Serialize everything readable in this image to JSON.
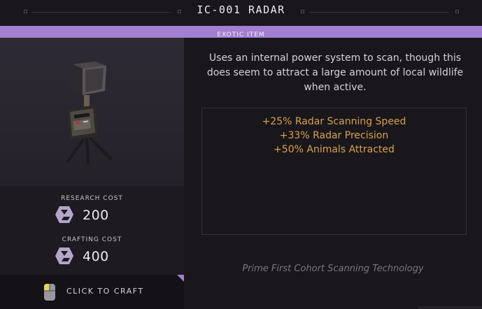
{
  "header": {
    "title": "IC-001 RADAR"
  },
  "rarity": {
    "label": "EXOTIC ITEM",
    "color": "#a27fd0"
  },
  "item": {
    "name": "IC-001 RADAR",
    "image_icon": "radar-device-icon"
  },
  "costs": {
    "research": {
      "label": "RESEARCH COST",
      "value": "200",
      "icon": "currency-icon"
    },
    "crafting": {
      "label": "CRAFTING COST",
      "value": "400",
      "icon": "currency-icon"
    }
  },
  "craft_button": {
    "label": "CLICK TO CRAFT",
    "icon": "mouse-left-click-icon"
  },
  "description": "Uses an internal power system to scan, though this does seem to attract a large amount of local wildlife when active.",
  "stats": [
    "+25% Radar Scanning Speed",
    "+33% Radar Precision",
    "+50% Animals Attracted"
  ],
  "stat_color": "#d9a14c",
  "flavor_text": "Prime First Cohort Scanning Technology"
}
